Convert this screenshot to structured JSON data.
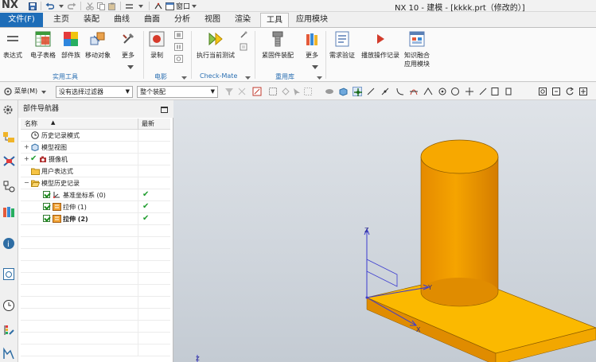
{
  "app": {
    "logo": "NX",
    "title": "NX 10 - 建模 - [kkkk.prt（修改的）]",
    "window_menu": "窗口",
    "accent": "#1e6db8"
  },
  "tabs": [
    {
      "label": "文件(F)"
    },
    {
      "label": "主页"
    },
    {
      "label": "装配"
    },
    {
      "label": "曲线"
    },
    {
      "label": "曲面"
    },
    {
      "label": "分析"
    },
    {
      "label": "视图"
    },
    {
      "label": "渲染"
    },
    {
      "label": "工具"
    },
    {
      "label": "应用模块"
    }
  ],
  "ribbon": {
    "groups": [
      {
        "label": "实用工具",
        "buttons": [
          "表达式",
          "电子表格",
          "部件族",
          "移动对象",
          "更多"
        ]
      },
      {
        "label": "电影",
        "buttons": [
          "录制"
        ]
      },
      {
        "label": "Check-Mate",
        "buttons": [
          "执行当前测试"
        ]
      },
      {
        "label": "重用库",
        "buttons": [
          "紧固件装配",
          "更多"
        ]
      },
      {
        "label": "",
        "buttons": [
          "需求验证",
          "播放操作记录",
          "知识融合应用模块"
        ]
      }
    ]
  },
  "toolbar": {
    "menu_label": "菜单(M)",
    "filter_value": "没有选择过滤器",
    "scope_value": "整个装配"
  },
  "navigator": {
    "title": "部件导航器",
    "col_name": "名称",
    "col_latest": "最新",
    "rows": [
      {
        "label": "历史记录模式"
      },
      {
        "label": "模型视图"
      },
      {
        "label": "摄像机"
      },
      {
        "label": "用户表达式"
      },
      {
        "label": "模型历史记录"
      },
      {
        "label": "基准坐标系 (0)"
      },
      {
        "label": "拉伸 (1)"
      },
      {
        "label": "拉伸 (2)"
      }
    ]
  },
  "viewport": {
    "axis_labels": {
      "z_top": "Z",
      "y": "Y",
      "x": "X",
      "z_bottom": "Z"
    },
    "model_color": "#f5a400"
  }
}
